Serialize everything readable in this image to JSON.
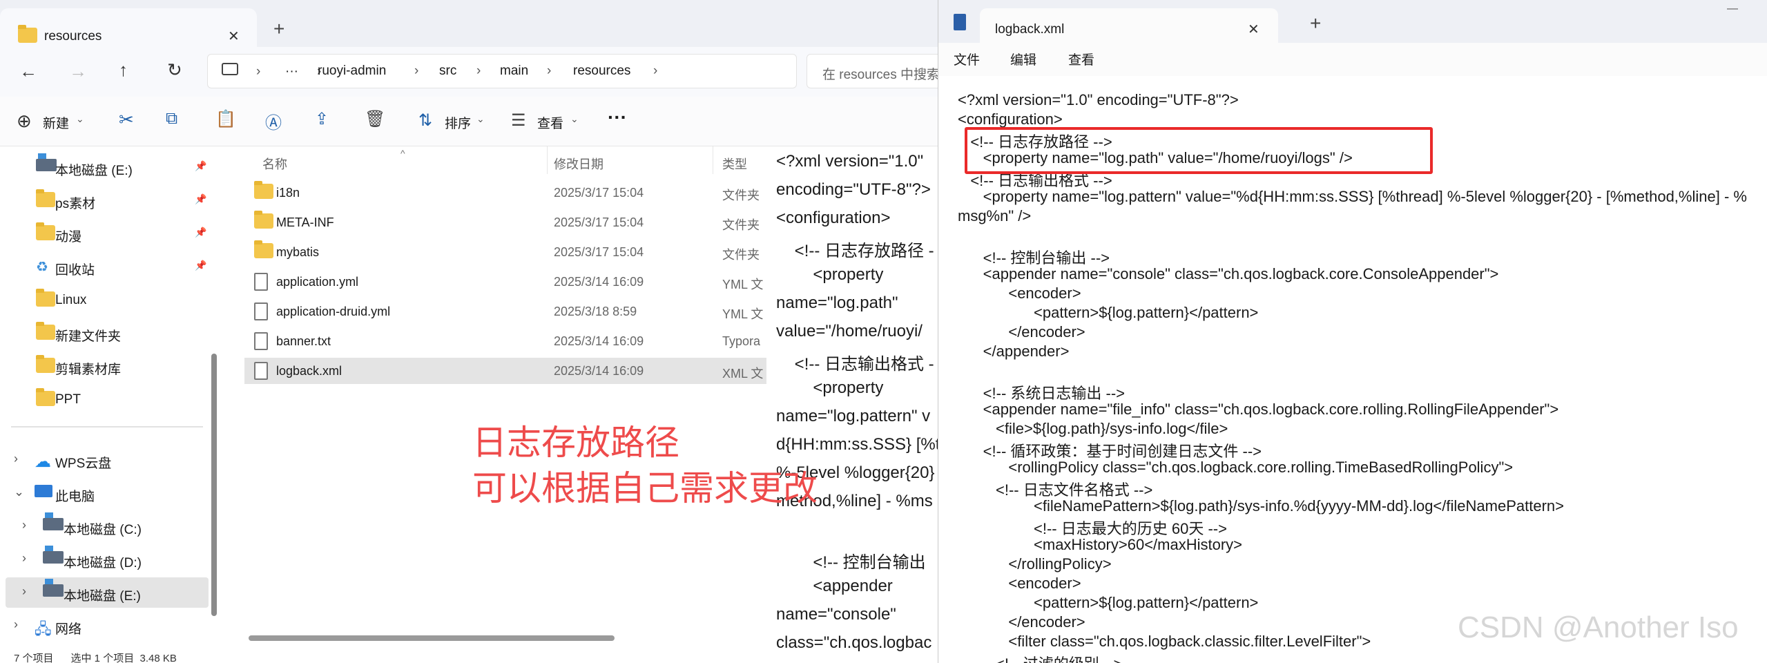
{
  "explorer": {
    "tab_title": "resources",
    "tab_close": "✕",
    "tab_add": "+",
    "breadcrumb": [
      "ruoyi-admin",
      "src",
      "main",
      "resources"
    ],
    "breadcrumb_more": "···",
    "search_placeholder": "在 resources 中搜索",
    "toolbar": {
      "new_label": "新建",
      "sort_label": "排序",
      "view_label": "查看",
      "more": "···"
    },
    "columns": {
      "name": "名称",
      "modified": "修改日期",
      "type": "类型"
    },
    "files": [
      {
        "name": "i18n",
        "date": "2025/3/17 15:04",
        "type": "文件夹",
        "icon": "folder"
      },
      {
        "name": "META-INF",
        "date": "2025/3/17 15:04",
        "type": "文件夹",
        "icon": "folder"
      },
      {
        "name": "mybatis",
        "date": "2025/3/17 15:04",
        "type": "文件夹",
        "icon": "folder"
      },
      {
        "name": "application.yml",
        "date": "2025/3/14 16:09",
        "type": "YML 文",
        "icon": "file"
      },
      {
        "name": "application-druid.yml",
        "date": "2025/3/18 8:59",
        "type": "YML 文",
        "icon": "file"
      },
      {
        "name": "banner.txt",
        "date": "2025/3/14 16:09",
        "type": "Typora",
        "icon": "file"
      },
      {
        "name": "logback.xml",
        "date": "2025/3/14 16:09",
        "type": "XML 文",
        "icon": "file"
      }
    ],
    "sidebar_quick": [
      {
        "label": "本地磁盘 (E:)",
        "icon": "drive"
      },
      {
        "label": "ps素材",
        "icon": "folder"
      },
      {
        "label": "动漫",
        "icon": "folder"
      },
      {
        "label": "回收站",
        "icon": "recycle"
      },
      {
        "label": "Linux",
        "icon": "folder"
      },
      {
        "label": "新建文件夹",
        "icon": "folder"
      },
      {
        "label": "剪辑素材库",
        "icon": "folder"
      },
      {
        "label": "PPT",
        "icon": "folder"
      }
    ],
    "sidebar_tree": [
      {
        "label": "WPS云盘",
        "icon": "cloud",
        "arrow": "›"
      },
      {
        "label": "此电脑",
        "icon": "monitor",
        "arrow": "⌄"
      },
      {
        "label": "本地磁盘 (C:)",
        "icon": "drive",
        "arrow": "›"
      },
      {
        "label": "本地磁盘 (D:)",
        "icon": "drive",
        "arrow": "›"
      },
      {
        "label": "本地磁盘 (E:)",
        "icon": "drive",
        "arrow": "›"
      },
      {
        "label": "网络",
        "icon": "network",
        "arrow": "›"
      }
    ],
    "status_bar": "7 个项目      选中 1 个项目  3.48 KB",
    "preview_lines": [
      "<?xml version=\"1.0\"",
      "encoding=\"UTF-8\"?>",
      "<configuration>",
      "    <!-- 日志存放路径 -",
      "        <property",
      "name=\"log.path\"",
      "value=\"/home/ruoyi/",
      "    <!-- 日志输出格式 -",
      "        <property",
      "name=\"log.pattern\" v",
      "d{HH:mm:ss.SSS} [%t",
      "%-5level %logger{20}",
      "method,%line] - %ms",
      "",
      "        <!-- 控制台输出",
      "        <appender",
      "name=\"console\"",
      "class=\"ch.qos.logbac"
    ],
    "annotation_line1": "日志存放路径",
    "annotation_line2": "可以根据自己需求更改"
  },
  "notepad": {
    "tab_title": "logback.xml",
    "tab_close": "✕",
    "tab_add": "+",
    "menu": [
      "文件",
      "编辑",
      "查看"
    ],
    "minimize": "—",
    "lines": [
      "<?xml version=\"1.0\" encoding=\"UTF-8\"?>",
      "<configuration>",
      "   <!-- 日志存放路径 -->",
      "      <property name=\"log.path\" value=\"/home/ruoyi/logs\" />",
      "   <!-- 日志输出格式 -->",
      "      <property name=\"log.pattern\" value=\"%d{HH:mm:ss.SSS} [%thread] %-5level %logger{20} - [%method,%line] - %",
      "msg%n\" />",
      "",
      "      <!-- 控制台输出 -->",
      "      <appender name=\"console\" class=\"ch.qos.logback.core.ConsoleAppender\">",
      "            <encoder>",
      "                  <pattern>${log.pattern}</pattern>",
      "            </encoder>",
      "      </appender>",
      "",
      "      <!-- 系统日志输出 -->",
      "      <appender name=\"file_info\" class=\"ch.qos.logback.core.rolling.RollingFileAppender\">",
      "         <file>${log.path}/sys-info.log</file>",
      "      <!-- 循环政策：基于时间创建日志文件 -->",
      "            <rollingPolicy class=\"ch.qos.logback.core.rolling.TimeBasedRollingPolicy\">",
      "         <!-- 日志文件名格式 -->",
      "                  <fileNamePattern>${log.path}/sys-info.%d{yyyy-MM-dd}.log</fileNamePattern>",
      "                  <!-- 日志最大的历史 60天 -->",
      "                  <maxHistory>60</maxHistory>",
      "            </rollingPolicy>",
      "            <encoder>",
      "                  <pattern>${log.pattern}</pattern>",
      "            </encoder>",
      "            <filter class=\"ch.qos.logback.classic.filter.LevelFilter\">",
      "         <!-- 过滤的级别 -->"
    ],
    "watermark": "CSDN @Another Iso"
  },
  "colors": {
    "annotation": "#ee4b4b",
    "highlight_box": "#ea2a2a",
    "folder": "#f3c64b"
  }
}
